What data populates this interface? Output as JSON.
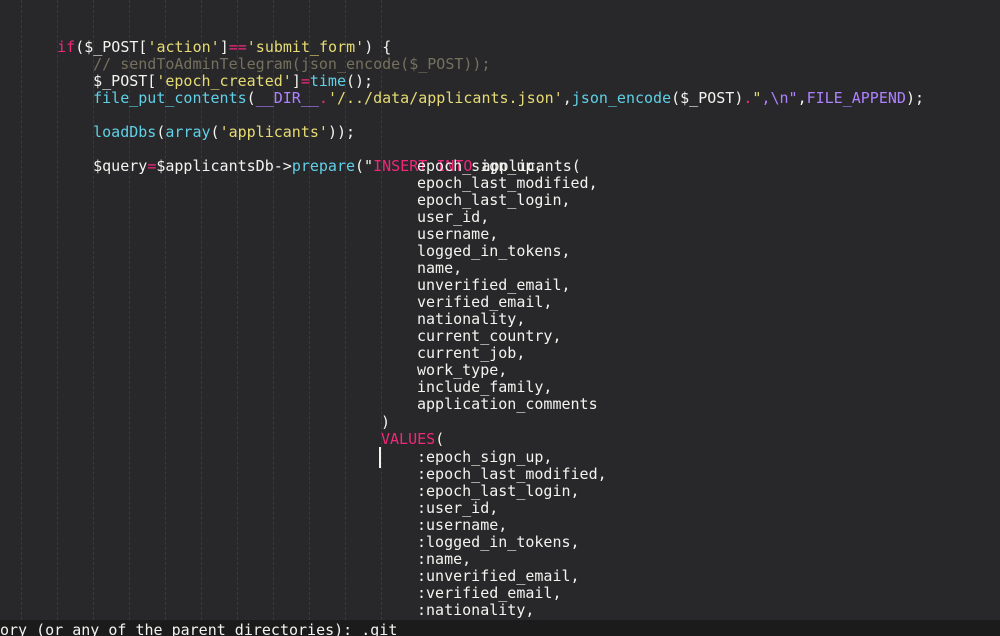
{
  "theme": {
    "background": "#28282a",
    "text": "#f3f3ef",
    "keyword": "#f0277a",
    "string": "#e6db74",
    "function": "#5fd0e8",
    "comment": "#75715e",
    "constant": "#ae81ff",
    "statusbar": "#1b1b1c"
  },
  "code": {
    "l1": {
      "t1": "if",
      "t2": "($_POST[",
      "t3": "'action'",
      "t4": "]",
      "t5": "==",
      "t6": "'submit_form'",
      "t7": ") {"
    },
    "l2": {
      "t1": "// sendToAdminTelegram(json_encode($_POST));"
    },
    "l3": {
      "t1": "$_POST[",
      "t2": "'epoch_created'",
      "t3": "]",
      "t4": "=",
      "t5": "time",
      "t6": "();"
    },
    "l4": {
      "t1": "file_put_contents",
      "t2": "(",
      "t3": "__DIR__",
      "t4": ".",
      "t5": "'/../data/applicants.json'",
      "t6": ",",
      "t7": "json_encode",
      "t8": "($_POST)",
      "t9": ".",
      "t10": "\"",
      "t11": ",\\n\"",
      "t12": ",",
      "t13": "FILE_APPEND",
      "t14": ");"
    },
    "l5": {
      "t1": "loadDbs",
      "t2": "(",
      "t3": "array",
      "t4": "(",
      "t5": "'applicants'",
      "t6": "));"
    },
    "l6": {
      "t1": "$query",
      "t2": "=",
      "t3": "$applicantsDb->",
      "t4": "prepare",
      "t5": "(\"",
      "t6": "INSERT",
      "t7": " ",
      "t8": "INTO",
      "t9": " applicants("
    },
    "columns": [
      "epoch_sign_up,",
      "epoch_last_modified,",
      "epoch_last_login,",
      "user_id,",
      "username,",
      "logged_in_tokens,",
      "name,",
      "unverified_email,",
      "verified_email,",
      "nationality,",
      "current_country,",
      "current_job,",
      "work_type,",
      "include_family,",
      "application_comments"
    ],
    "close_paren": ")",
    "values_kw": "VALUES",
    "values_paren": "(",
    "placeholders": [
      ":epoch_sign_up,",
      ":epoch_last_modified,",
      ":epoch_last_login,",
      ":user_id,",
      ":username,",
      ":logged_in_tokens,",
      ":name,",
      ":unverified_email,",
      ":verified_email,",
      ":nationality,"
    ]
  },
  "status": {
    "text": "ory (or any of the parent directories): .git"
  }
}
